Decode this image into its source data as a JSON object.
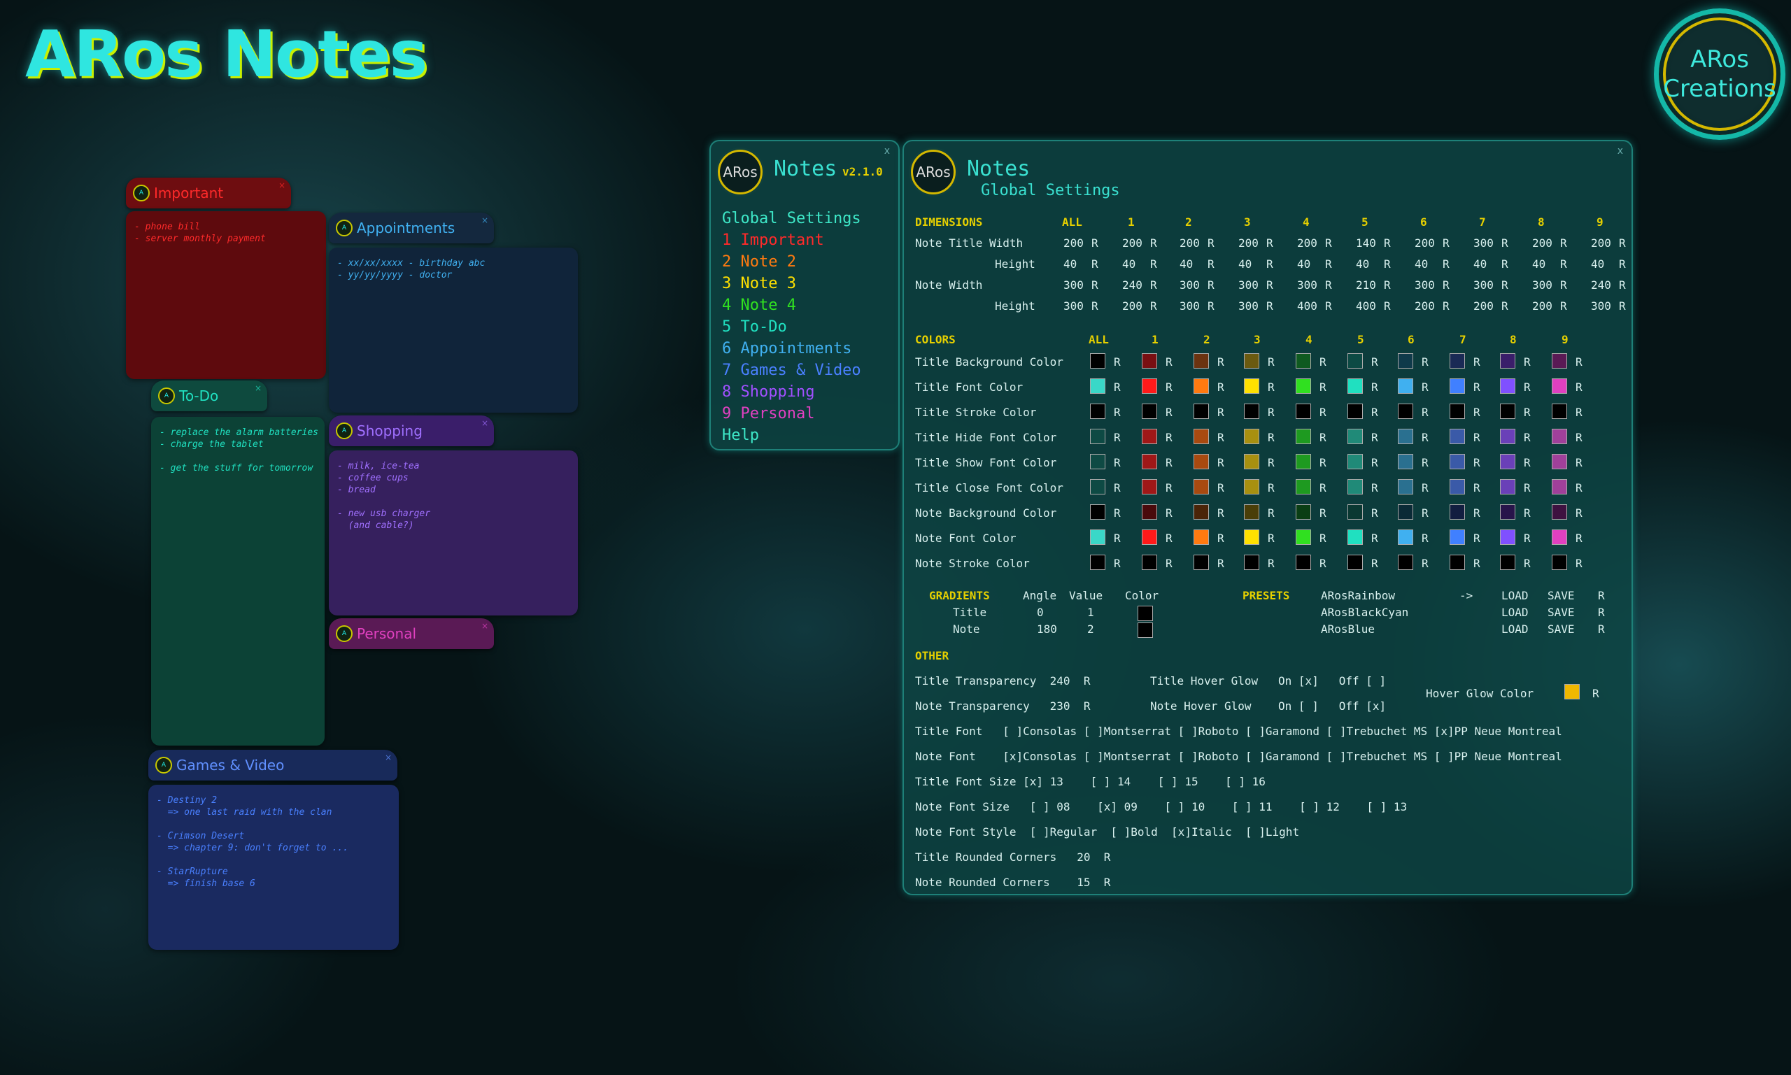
{
  "app_title": "ARos Notes",
  "brand": {
    "line1": "ARos",
    "line2": "Creations"
  },
  "notes": [
    {
      "title": "Important",
      "lines": "- phone bill\n- server monthly payment"
    },
    {
      "title": "Appointments",
      "lines": "- xx/xx/xxxx - birthday abc\n- yy/yy/yyyy - doctor"
    },
    {
      "title": "To-Do",
      "lines": "- replace the alarm batteries\n- charge the tablet\n\n- get the stuff for tomorrow"
    },
    {
      "title": "Shopping",
      "lines": "- milk, ice-tea\n- coffee cups\n- bread\n\n- new usb charger\n  (and cable?)"
    },
    {
      "title": "Personal",
      "lines": ""
    },
    {
      "title": "Games & Video",
      "lines": "- Destiny 2\n  => one last raid with the clan\n\n- Crimson Desert\n  => chapter 9: don't forget to ...\n\n- StarRupture\n  => finish base 6"
    }
  ],
  "menu": {
    "logo": "ARos",
    "title": "Notes",
    "version": "v2.1.0",
    "close": "x",
    "items": [
      "Global Settings",
      "1  Important",
      "2  Note 2",
      "3  Note 3",
      "4  Note 4",
      "5  To-Do",
      "6  Appointments",
      "7  Games & Video",
      "8  Shopping",
      "9  Personal",
      "Help"
    ]
  },
  "settings": {
    "logo": "ARos",
    "title": "Notes",
    "subtitle": "Global Settings",
    "close": "x",
    "dimensions": {
      "header": "DIMENSIONS",
      "cols": [
        "ALL",
        "1",
        "2",
        "3",
        "4",
        "5",
        "6",
        "7",
        "8",
        "9"
      ],
      "rows": [
        {
          "label": "Note Title Width",
          "values": [
            "200",
            "200",
            "200",
            "200",
            "200",
            "140",
            "200",
            "300",
            "200",
            "200"
          ]
        },
        {
          "label": "Height",
          "values": [
            "40",
            "40",
            "40",
            "40",
            "40",
            "40",
            "40",
            "40",
            "40",
            "40"
          ]
        },
        {
          "label": "Note Width",
          "values": [
            "300",
            "240",
            "300",
            "300",
            "300",
            "210",
            "300",
            "300",
            "300",
            "240"
          ]
        },
        {
          "label": "Height",
          "values": [
            "300",
            "200",
            "300",
            "300",
            "400",
            "400",
            "200",
            "200",
            "200",
            "300"
          ]
        }
      ]
    },
    "colors": {
      "header": "COLORS",
      "cols": [
        "ALL",
        "1",
        "2",
        "3",
        "4",
        "5",
        "6",
        "7",
        "8",
        "9"
      ],
      "rows": [
        {
          "label": "Title Background Color",
          "swatches": [
            "#000000",
            "#7a0f12",
            "#6b3310",
            "#6b5a10",
            "#0f5a20",
            "#0d4a44",
            "#0f3a4a",
            "#1a2a55",
            "#3a1e6a",
            "#5a1a55"
          ]
        },
        {
          "label": "Title Font Color",
          "swatches": [
            "#3ad8c8",
            "#ff1a1a",
            "#ff7a10",
            "#ffe000",
            "#30e020",
            "#20e0c0",
            "#40b0f0",
            "#4080ff",
            "#8050ff",
            "#e040c0"
          ]
        },
        {
          "label": "Title Stroke Color",
          "swatches": [
            "#000000",
            "#000000",
            "#000000",
            "#000000",
            "#000000",
            "#000000",
            "#000000",
            "#000000",
            "#000000",
            "#000000"
          ]
        },
        {
          "label": "Title Hide Font Color",
          "swatches": [
            "#0e4a44",
            "#a01818",
            "#a84a10",
            "#a89010",
            "#1e9a20",
            "#208a78",
            "#2a7090",
            "#3a5aa8",
            "#6a40b8",
            "#a0409a"
          ]
        },
        {
          "label": "Title Show Font Color",
          "swatches": [
            "#0e4a44",
            "#a01818",
            "#a84a10",
            "#a89010",
            "#1e9a20",
            "#208a78",
            "#2a7090",
            "#3a5aa8",
            "#6a40b8",
            "#a0409a"
          ]
        },
        {
          "label": "Title Close Font Color",
          "swatches": [
            "#0e4a44",
            "#a01818",
            "#a84a10",
            "#a89010",
            "#1e9a20",
            "#208a78",
            "#2a7090",
            "#3a5aa8",
            "#6a40b8",
            "#a0409a"
          ]
        },
        {
          "label": "Note Background Color",
          "swatches": [
            "#000000",
            "#4a0a0c",
            "#4a2408",
            "#4a3e08",
            "#0a3e14",
            "#0a3832",
            "#0a2a36",
            "#121e40",
            "#28144a",
            "#3e1240"
          ]
        },
        {
          "label": "Note Font Color",
          "swatches": [
            "#3ad8c8",
            "#ff1a1a",
            "#ff7a10",
            "#ffe000",
            "#30e020",
            "#20e0c0",
            "#40b0f0",
            "#4080ff",
            "#8050ff",
            "#e040c0"
          ]
        },
        {
          "label": "Note Stroke Color",
          "swatches": [
            "#000000",
            "#000000",
            "#000000",
            "#000000",
            "#000000",
            "#000000",
            "#000000",
            "#000000",
            "#000000",
            "#000000"
          ]
        }
      ]
    },
    "gradients": {
      "header": "GRADIENTS",
      "cols": [
        "Angle",
        "Value",
        "Color"
      ],
      "rows": [
        {
          "label": "Title",
          "angle": "0",
          "value": "1"
        },
        {
          "label": "Note",
          "angle": "180",
          "value": "2"
        }
      ]
    },
    "presets": {
      "header": "PRESETS",
      "arrow": "->",
      "items": [
        {
          "name": "ARosRainbow"
        },
        {
          "name": "ARosBlackCyan"
        },
        {
          "name": "ARosBlue"
        }
      ],
      "load": "LOAD",
      "save": "SAVE",
      "reset": "R"
    },
    "other_header": "OTHER",
    "other": [
      "Title Transparency  240  R",
      "Note Transparency   230  R",
      "Title Font   [ ]Consolas [ ]Montserrat [ ]Roboto [ ]Garamond [ ]Trebuchet MS [x]PP Neue Montreal",
      "Note Font    [x]Consolas [ ]Montserrat [ ]Roboto [ ]Garamond [ ]Trebuchet MS [ ]PP Neue Montreal",
      "Title Font Size [x] 13    [ ] 14    [ ] 15    [ ] 16",
      "Note Font Size   [ ] 08    [x] 09    [ ] 10    [ ] 11    [ ] 12    [ ] 13",
      "Note Font Style  [ ]Regular  [ ]Bold  [x]Italic  [ ]Light",
      "Title Rounded Corners   20  R",
      "Note Rounded Corners    15  R"
    ],
    "glow": [
      "Title Hover Glow   On [x]   Off [ ]",
      "Note Hover Glow    On [ ]   Off [x]"
    ],
    "hover_glow_color": {
      "label": "Hover Glow Color",
      "color": "#f0b800",
      "reset": "R"
    },
    "reset": "R"
  }
}
